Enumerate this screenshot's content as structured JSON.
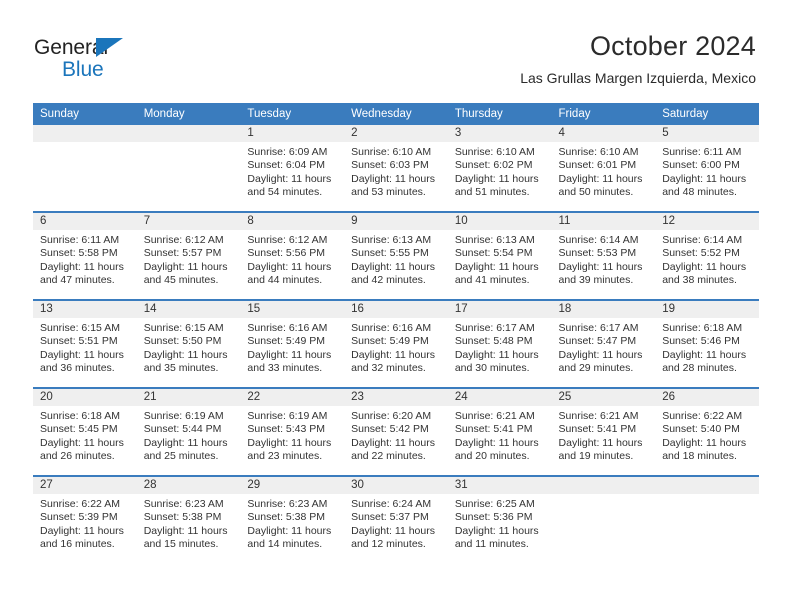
{
  "brand": {
    "line1": "General",
    "line2": "Blue",
    "logo_color": "#1b75bb",
    "icon": "triangle-logo-icon"
  },
  "header": {
    "title": "October 2024",
    "subtitle": "Las Grullas Margen Izquierda, Mexico"
  },
  "theme": {
    "header_blue": "#3a7cbe",
    "daynum_band": "#efefef",
    "text": "#333333"
  },
  "calendar": {
    "weekday_headers": [
      "Sunday",
      "Monday",
      "Tuesday",
      "Wednesday",
      "Thursday",
      "Friday",
      "Saturday"
    ],
    "weeks": [
      [
        {
          "day": "",
          "sunrise": "",
          "sunset": "",
          "daylight1": "",
          "daylight2": ""
        },
        {
          "day": "",
          "sunrise": "",
          "sunset": "",
          "daylight1": "",
          "daylight2": ""
        },
        {
          "day": "1",
          "sunrise": "Sunrise: 6:09 AM",
          "sunset": "Sunset: 6:04 PM",
          "daylight1": "Daylight: 11 hours",
          "daylight2": "and 54 minutes."
        },
        {
          "day": "2",
          "sunrise": "Sunrise: 6:10 AM",
          "sunset": "Sunset: 6:03 PM",
          "daylight1": "Daylight: 11 hours",
          "daylight2": "and 53 minutes."
        },
        {
          "day": "3",
          "sunrise": "Sunrise: 6:10 AM",
          "sunset": "Sunset: 6:02 PM",
          "daylight1": "Daylight: 11 hours",
          "daylight2": "and 51 minutes."
        },
        {
          "day": "4",
          "sunrise": "Sunrise: 6:10 AM",
          "sunset": "Sunset: 6:01 PM",
          "daylight1": "Daylight: 11 hours",
          "daylight2": "and 50 minutes."
        },
        {
          "day": "5",
          "sunrise": "Sunrise: 6:11 AM",
          "sunset": "Sunset: 6:00 PM",
          "daylight1": "Daylight: 11 hours",
          "daylight2": "and 48 minutes."
        }
      ],
      [
        {
          "day": "6",
          "sunrise": "Sunrise: 6:11 AM",
          "sunset": "Sunset: 5:58 PM",
          "daylight1": "Daylight: 11 hours",
          "daylight2": "and 47 minutes."
        },
        {
          "day": "7",
          "sunrise": "Sunrise: 6:12 AM",
          "sunset": "Sunset: 5:57 PM",
          "daylight1": "Daylight: 11 hours",
          "daylight2": "and 45 minutes."
        },
        {
          "day": "8",
          "sunrise": "Sunrise: 6:12 AM",
          "sunset": "Sunset: 5:56 PM",
          "daylight1": "Daylight: 11 hours",
          "daylight2": "and 44 minutes."
        },
        {
          "day": "9",
          "sunrise": "Sunrise: 6:13 AM",
          "sunset": "Sunset: 5:55 PM",
          "daylight1": "Daylight: 11 hours",
          "daylight2": "and 42 minutes."
        },
        {
          "day": "10",
          "sunrise": "Sunrise: 6:13 AM",
          "sunset": "Sunset: 5:54 PM",
          "daylight1": "Daylight: 11 hours",
          "daylight2": "and 41 minutes."
        },
        {
          "day": "11",
          "sunrise": "Sunrise: 6:14 AM",
          "sunset": "Sunset: 5:53 PM",
          "daylight1": "Daylight: 11 hours",
          "daylight2": "and 39 minutes."
        },
        {
          "day": "12",
          "sunrise": "Sunrise: 6:14 AM",
          "sunset": "Sunset: 5:52 PM",
          "daylight1": "Daylight: 11 hours",
          "daylight2": "and 38 minutes."
        }
      ],
      [
        {
          "day": "13",
          "sunrise": "Sunrise: 6:15 AM",
          "sunset": "Sunset: 5:51 PM",
          "daylight1": "Daylight: 11 hours",
          "daylight2": "and 36 minutes."
        },
        {
          "day": "14",
          "sunrise": "Sunrise: 6:15 AM",
          "sunset": "Sunset: 5:50 PM",
          "daylight1": "Daylight: 11 hours",
          "daylight2": "and 35 minutes."
        },
        {
          "day": "15",
          "sunrise": "Sunrise: 6:16 AM",
          "sunset": "Sunset: 5:49 PM",
          "daylight1": "Daylight: 11 hours",
          "daylight2": "and 33 minutes."
        },
        {
          "day": "16",
          "sunrise": "Sunrise: 6:16 AM",
          "sunset": "Sunset: 5:49 PM",
          "daylight1": "Daylight: 11 hours",
          "daylight2": "and 32 minutes."
        },
        {
          "day": "17",
          "sunrise": "Sunrise: 6:17 AM",
          "sunset": "Sunset: 5:48 PM",
          "daylight1": "Daylight: 11 hours",
          "daylight2": "and 30 minutes."
        },
        {
          "day": "18",
          "sunrise": "Sunrise: 6:17 AM",
          "sunset": "Sunset: 5:47 PM",
          "daylight1": "Daylight: 11 hours",
          "daylight2": "and 29 minutes."
        },
        {
          "day": "19",
          "sunrise": "Sunrise: 6:18 AM",
          "sunset": "Sunset: 5:46 PM",
          "daylight1": "Daylight: 11 hours",
          "daylight2": "and 28 minutes."
        }
      ],
      [
        {
          "day": "20",
          "sunrise": "Sunrise: 6:18 AM",
          "sunset": "Sunset: 5:45 PM",
          "daylight1": "Daylight: 11 hours",
          "daylight2": "and 26 minutes."
        },
        {
          "day": "21",
          "sunrise": "Sunrise: 6:19 AM",
          "sunset": "Sunset: 5:44 PM",
          "daylight1": "Daylight: 11 hours",
          "daylight2": "and 25 minutes."
        },
        {
          "day": "22",
          "sunrise": "Sunrise: 6:19 AM",
          "sunset": "Sunset: 5:43 PM",
          "daylight1": "Daylight: 11 hours",
          "daylight2": "and 23 minutes."
        },
        {
          "day": "23",
          "sunrise": "Sunrise: 6:20 AM",
          "sunset": "Sunset: 5:42 PM",
          "daylight1": "Daylight: 11 hours",
          "daylight2": "and 22 minutes."
        },
        {
          "day": "24",
          "sunrise": "Sunrise: 6:21 AM",
          "sunset": "Sunset: 5:41 PM",
          "daylight1": "Daylight: 11 hours",
          "daylight2": "and 20 minutes."
        },
        {
          "day": "25",
          "sunrise": "Sunrise: 6:21 AM",
          "sunset": "Sunset: 5:41 PM",
          "daylight1": "Daylight: 11 hours",
          "daylight2": "and 19 minutes."
        },
        {
          "day": "26",
          "sunrise": "Sunrise: 6:22 AM",
          "sunset": "Sunset: 5:40 PM",
          "daylight1": "Daylight: 11 hours",
          "daylight2": "and 18 minutes."
        }
      ],
      [
        {
          "day": "27",
          "sunrise": "Sunrise: 6:22 AM",
          "sunset": "Sunset: 5:39 PM",
          "daylight1": "Daylight: 11 hours",
          "daylight2": "and 16 minutes."
        },
        {
          "day": "28",
          "sunrise": "Sunrise: 6:23 AM",
          "sunset": "Sunset: 5:38 PM",
          "daylight1": "Daylight: 11 hours",
          "daylight2": "and 15 minutes."
        },
        {
          "day": "29",
          "sunrise": "Sunrise: 6:23 AM",
          "sunset": "Sunset: 5:38 PM",
          "daylight1": "Daylight: 11 hours",
          "daylight2": "and 14 minutes."
        },
        {
          "day": "30",
          "sunrise": "Sunrise: 6:24 AM",
          "sunset": "Sunset: 5:37 PM",
          "daylight1": "Daylight: 11 hours",
          "daylight2": "and 12 minutes."
        },
        {
          "day": "31",
          "sunrise": "Sunrise: 6:25 AM",
          "sunset": "Sunset: 5:36 PM",
          "daylight1": "Daylight: 11 hours",
          "daylight2": "and 11 minutes."
        },
        {
          "day": "",
          "sunrise": "",
          "sunset": "",
          "daylight1": "",
          "daylight2": ""
        },
        {
          "day": "",
          "sunrise": "",
          "sunset": "",
          "daylight1": "",
          "daylight2": ""
        }
      ]
    ]
  }
}
